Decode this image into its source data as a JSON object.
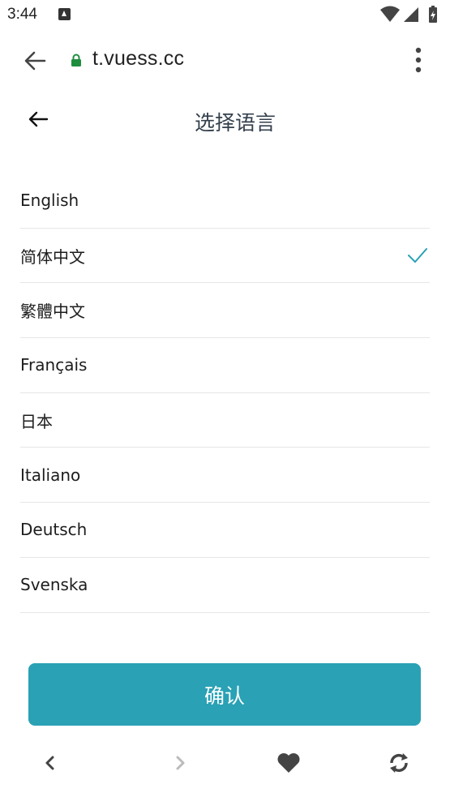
{
  "status_bar": {
    "time": "3:44"
  },
  "browser": {
    "url": "t.vuess.cc"
  },
  "header": {
    "title": "选择语言"
  },
  "languages": [
    {
      "label": "English",
      "selected": false
    },
    {
      "label": "简体中文",
      "selected": true
    },
    {
      "label": "繁體中文",
      "selected": false
    },
    {
      "label": "Français",
      "selected": false
    },
    {
      "label": "日本",
      "selected": false
    },
    {
      "label": "Italiano",
      "selected": false
    },
    {
      "label": "Deutsch",
      "selected": false
    },
    {
      "label": "Svenska",
      "selected": false
    }
  ],
  "confirm_label": "确认",
  "colors": {
    "accent": "#2aa1b5",
    "lock": "#1e8e3e"
  },
  "icons": {
    "browser_back": "arrow-left-icon",
    "lock": "lock-icon",
    "menu": "more-vert-icon",
    "page_back": "arrow-left-icon",
    "check": "check-icon",
    "nav_back": "chevron-left-icon",
    "nav_forward": "chevron-right-icon",
    "favorite": "heart-icon",
    "refresh": "refresh-icon"
  }
}
